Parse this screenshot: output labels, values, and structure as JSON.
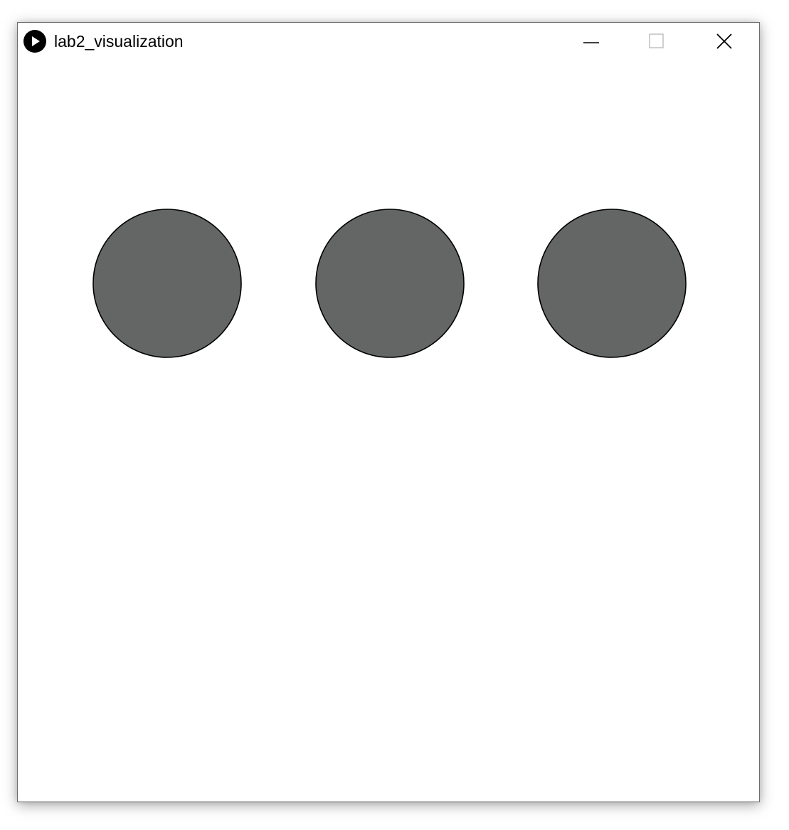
{
  "window": {
    "title": "lab2_visualization",
    "app_icon": "processing-play-icon",
    "controls": {
      "minimize": "minimize-icon",
      "maximize": "maximize-icon",
      "close": "close-icon"
    }
  },
  "canvas": {
    "background": "#ffffff",
    "circles": [
      {
        "fill": "#646665",
        "stroke": "#000000"
      },
      {
        "fill": "#646665",
        "stroke": "#000000"
      },
      {
        "fill": "#646665",
        "stroke": "#000000"
      }
    ]
  }
}
